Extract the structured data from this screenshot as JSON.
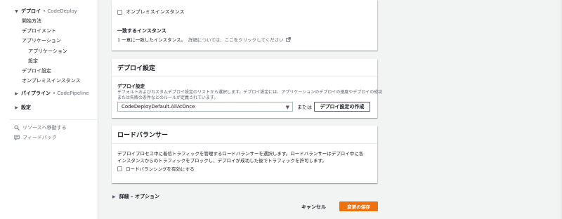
{
  "sidebar": {
    "deploy": {
      "label": "デプロイ",
      "service": "• CodeDeploy"
    },
    "deploy_items": [
      "開始方法",
      "デプロイメント",
      "アプリケーション"
    ],
    "app_sub": [
      "アプリケーション",
      "設定"
    ],
    "deploy_items_2": [
      "デプロイ設定",
      "オンプレミスインスタンス"
    ],
    "pipeline": {
      "label": "パイプライン",
      "service": "• CodePipeline"
    },
    "settings": {
      "label": "設定"
    },
    "goto_resource": "リソースへ移動する",
    "feedback": "フィードバック"
  },
  "main": {
    "env_card": {
      "onprem_checkbox_label": "オンプレミスインスタンス",
      "matching_title": "一致するインスタンス",
      "matching_text": "1 一意に一致したインスタンス。",
      "matching_link": "詳細については、ここをクリックしてください"
    },
    "deploy_config": {
      "title": "デプロイ設定",
      "field_label": "デプロイ設定",
      "description_1": "デフォルトおよびカスタムデプロイ設定のリストから選択します。デプロイ設定には、アプリケーションのデプロイの速度やデプロイの成功",
      "description_2": "または失敗の条件などのルールが定義されています。",
      "select_value": "CodeDeployDefault.AllAtOnce",
      "or_text": "または",
      "create_button": "デプロイ設定の作成"
    },
    "load_balancer": {
      "title": "ロードバランサー",
      "description_1": "デプロイプロセス中に着信トラフィックを管理するロードバランサーを選択します。ロードバランサーはデプロイ中に各",
      "description_2": "インスタンスからのトラフィックをブロックし、デプロイが成功した後でトラフィックを許可します。",
      "checkbox_label": "ロードバランシングを有効にする"
    },
    "advanced": "詳細 – オプション",
    "cancel": "キャンセル",
    "save": "変更の保存"
  },
  "colors": {
    "primary_button": "#ec7211",
    "background": "#f2f3f3"
  }
}
